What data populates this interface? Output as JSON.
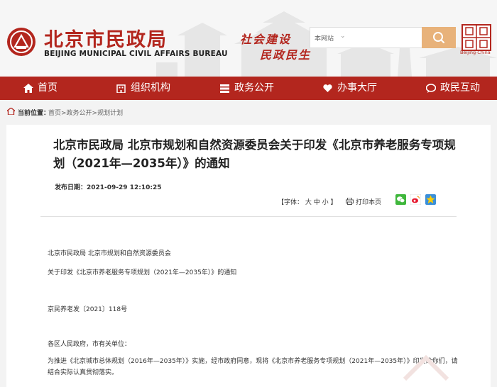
{
  "site": {
    "name_cn": "北京市民政局",
    "name_en": "BEIJING MUNICIPAL CIVIL AFFAIRS BUREAU",
    "slogan_line1": "社会建设",
    "slogan_line2": "民政民生",
    "seal_caption": "Beijing·China"
  },
  "search": {
    "scope": "本网站",
    "placeholder": ""
  },
  "nav": {
    "items": [
      {
        "label": "首页",
        "icon": "home-icon"
      },
      {
        "label": "组织机构",
        "icon": "building-icon"
      },
      {
        "label": "政务公开",
        "icon": "list-icon"
      },
      {
        "label": "办事大厅",
        "icon": "heart-icon"
      },
      {
        "label": "政民互动",
        "icon": "chat-icon"
      }
    ]
  },
  "breadcrumb": {
    "label": "当前位置：",
    "path": "首页>政务公开>规划计划"
  },
  "article": {
    "title": "北京市民政局 北京市规划和自然资源委员会关于印发《北京市养老服务专项规划（2021年—2035年）》的通知",
    "pubdate": "发布日期：2021-09-29 12:10:25",
    "font_size_label": "【字体： 大 中 小 】",
    "print_label": "打印本页",
    "paragraphs": [
      "北京市民政局 北京市规划和自然资源委员会",
      "关于印发《北京市养老服务专项规划（2021年—2035年）》的通知",
      "京民养老发〔2021〕118号",
      "各区人民政府，市有关单位：",
      "为推进《北京城市总体规划（2016年—2035年）》实施，经市政府同意，现将《北京市养老服务专项规划（2021年—2035年）》印发给你们，请结合实际认真贯彻落实。"
    ]
  },
  "colors": {
    "brand_red": "#b3261e",
    "search_button": "#e8b27a"
  }
}
